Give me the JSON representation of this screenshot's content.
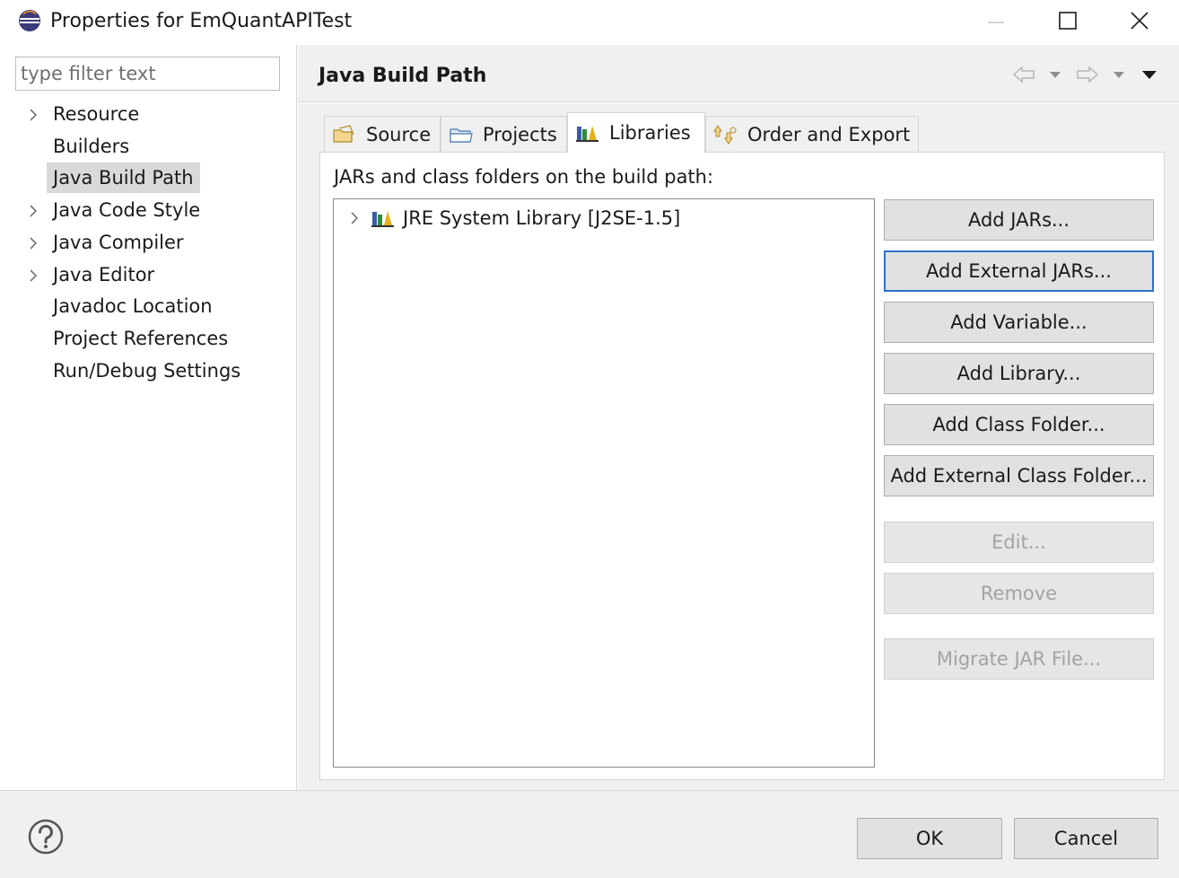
{
  "window": {
    "title": "Properties for EmQuantAPITest",
    "icons": {
      "app": "eclipse-icon",
      "minimize": "minimize-icon",
      "maximize": "maximize-icon",
      "close": "close-icon"
    }
  },
  "sidebar": {
    "filter_placeholder": "type filter text",
    "items": [
      {
        "label": "Resource",
        "expandable": true,
        "selected": false
      },
      {
        "label": "Builders",
        "expandable": false,
        "selected": false
      },
      {
        "label": "Java Build Path",
        "expandable": false,
        "selected": true
      },
      {
        "label": "Java Code Style",
        "expandable": true,
        "selected": false
      },
      {
        "label": "Java Compiler",
        "expandable": true,
        "selected": false
      },
      {
        "label": "Java Editor",
        "expandable": true,
        "selected": false
      },
      {
        "label": "Javadoc Location",
        "expandable": false,
        "selected": false
      },
      {
        "label": "Project References",
        "expandable": false,
        "selected": false
      },
      {
        "label": "Run/Debug Settings",
        "expandable": false,
        "selected": false
      }
    ]
  },
  "header": {
    "title": "Java Build Path",
    "nav_icons": [
      "back-arrow-icon",
      "dropdown-icon",
      "forward-arrow-icon",
      "dropdown-icon",
      "view-menu-icon"
    ]
  },
  "tabs": [
    {
      "label": "Source",
      "icon": "source-folder-icon",
      "active": false
    },
    {
      "label": "Projects",
      "icon": "projects-folder-icon",
      "active": false
    },
    {
      "label": "Libraries",
      "icon": "libraries-icon",
      "active": true
    },
    {
      "label": "Order and Export",
      "icon": "order-export-icon",
      "active": false
    }
  ],
  "libraries": {
    "label": "JARs and class folders on the build path:",
    "entries": [
      {
        "label": "JRE System Library [J2SE-1.5]",
        "icon": "library-icon"
      }
    ]
  },
  "buttons": {
    "add_jars": "Add JARs...",
    "add_external_jars": "Add External JARs...",
    "add_variable": "Add Variable...",
    "add_library": "Add Library...",
    "add_class_folder": "Add Class Folder...",
    "add_external_class_folder": "Add External Class Folder...",
    "edit": "Edit...",
    "remove": "Remove",
    "migrate_jar": "Migrate JAR File..."
  },
  "footer": {
    "ok": "OK",
    "cancel": "Cancel",
    "help_icon": "help-icon"
  },
  "colors": {
    "focus_border": "#2f73c8",
    "disabled_text": "#a3a3a3",
    "panel_bg": "#f0f0f0"
  }
}
